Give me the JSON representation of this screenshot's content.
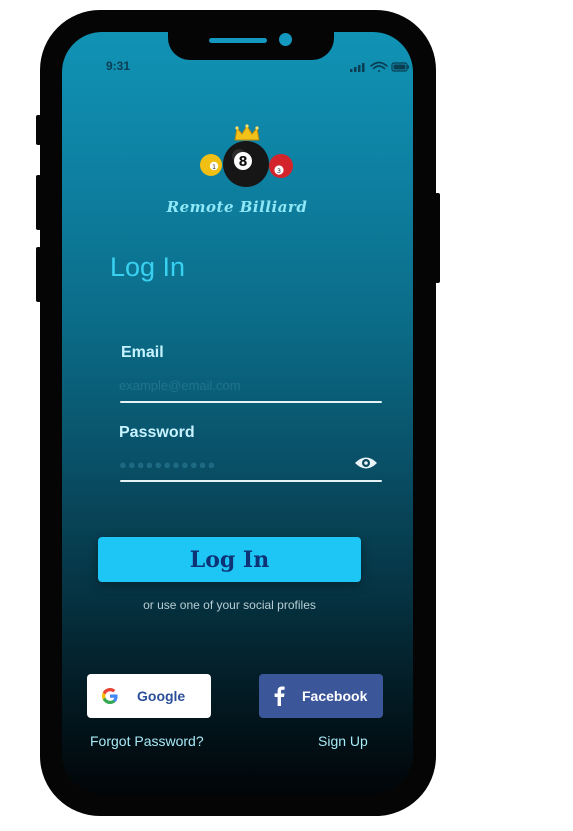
{
  "status_bar": {
    "time": "9:31"
  },
  "app": {
    "name": "Remote Billiard",
    "ball_number": "8",
    "side_ball_left": "1",
    "side_ball_right": "3"
  },
  "login": {
    "title": "Log In",
    "email_label": "Email",
    "email_placeholder": "example@email.com",
    "password_label": "Password",
    "password_placeholder": "●●●●●●●●●●●",
    "submit_label": "Log In",
    "social_prompt": "or use one of your social profiles"
  },
  "social": {
    "google_label": "Google",
    "facebook_label": "Facebook"
  },
  "links": {
    "forgot_password": "Forgot Password?",
    "sign_up": "Sign Up"
  },
  "icons": [
    "wifi-icon",
    "signal-icon",
    "battery-icon",
    "eye-icon",
    "google-icon",
    "facebook-icon",
    "crown-icon"
  ],
  "colors": {
    "accent": "#1ec6f5",
    "title": "#39d1f1",
    "button_text": "#0d3275",
    "facebook": "#3b579a"
  }
}
